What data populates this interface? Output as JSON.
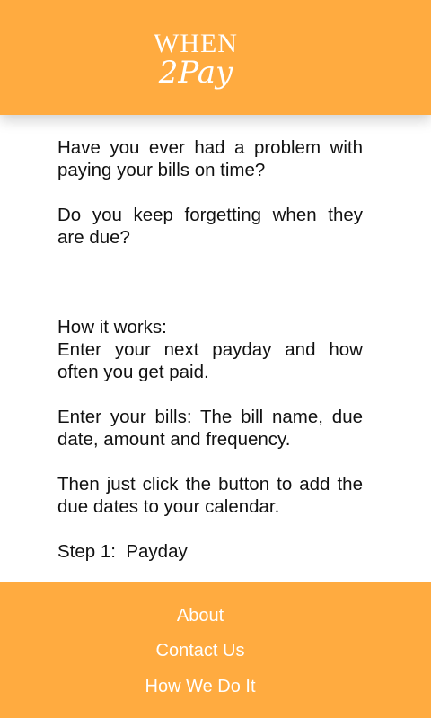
{
  "header": {
    "logo_line1": "WHEN",
    "logo_line2": "2Pay"
  },
  "content": {
    "intro_q1": "Have you ever had a problem with paying your bills on time?",
    "intro_q2": "Do you keep forgetting when they are due?",
    "how_title": "How it works:",
    "how_step_payday": "Enter your next payday and how often you get paid.",
    "how_step_bills": "Enter your bills: The bill name, due date, amount and frequency.",
    "how_step_click": "Then just click the button to add the due dates to your calendar.",
    "step1": "Step 1:  Payday"
  },
  "footer": {
    "links": [
      "About",
      "Contact Us",
      "How We Do It"
    ]
  },
  "colors": {
    "accent": "#FFAB40",
    "text": "#111111",
    "on_accent": "#FFFFFF"
  }
}
